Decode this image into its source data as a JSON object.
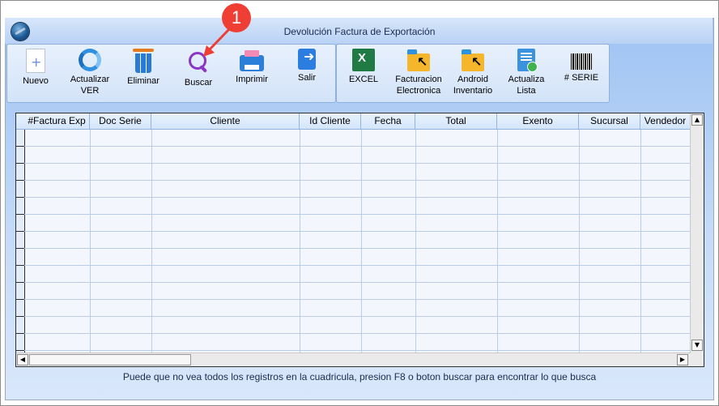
{
  "window": {
    "title": "Devolución  Factura de  Exportación"
  },
  "annotation": {
    "badge": "1"
  },
  "toolbar": {
    "left": [
      {
        "label": "Nuevo",
        "icon": "new-document-icon"
      },
      {
        "label": "Actualizar\nVER",
        "icon": "refresh-icon"
      },
      {
        "label": "Eliminar",
        "icon": "trash-icon"
      },
      {
        "label": "Buscar",
        "icon": "search-icon"
      },
      {
        "label": "Imprimir",
        "icon": "printer-icon"
      },
      {
        "label": "Salir",
        "icon": "exit-icon"
      }
    ],
    "right": [
      {
        "label": "EXCEL",
        "icon": "excel-icon"
      },
      {
        "label": "Facturacion\nElectronica",
        "icon": "folder-arrow-icon"
      },
      {
        "label": "Android\nInventario",
        "icon": "folder-arrow-icon"
      },
      {
        "label": "Actualiza\nLista",
        "icon": "list-refresh-icon"
      },
      {
        "label": "# SERIE",
        "icon": "barcode-icon"
      }
    ]
  },
  "grid": {
    "columns": [
      "#Factura Exp",
      "Doc Serie",
      "Cliente",
      "Id Cliente",
      "Fecha",
      "Total",
      "Exento",
      "Sucursal",
      "Vendedor"
    ],
    "rows": []
  },
  "status_text": "Puede que no vea todos los registros en la cuadricula, presion F8 o boton buscar para encontrar lo que busca",
  "colors": {
    "accent": "#2b7fd8",
    "badge": "#ef3e33",
    "window_bg": "#c7dcf8"
  }
}
